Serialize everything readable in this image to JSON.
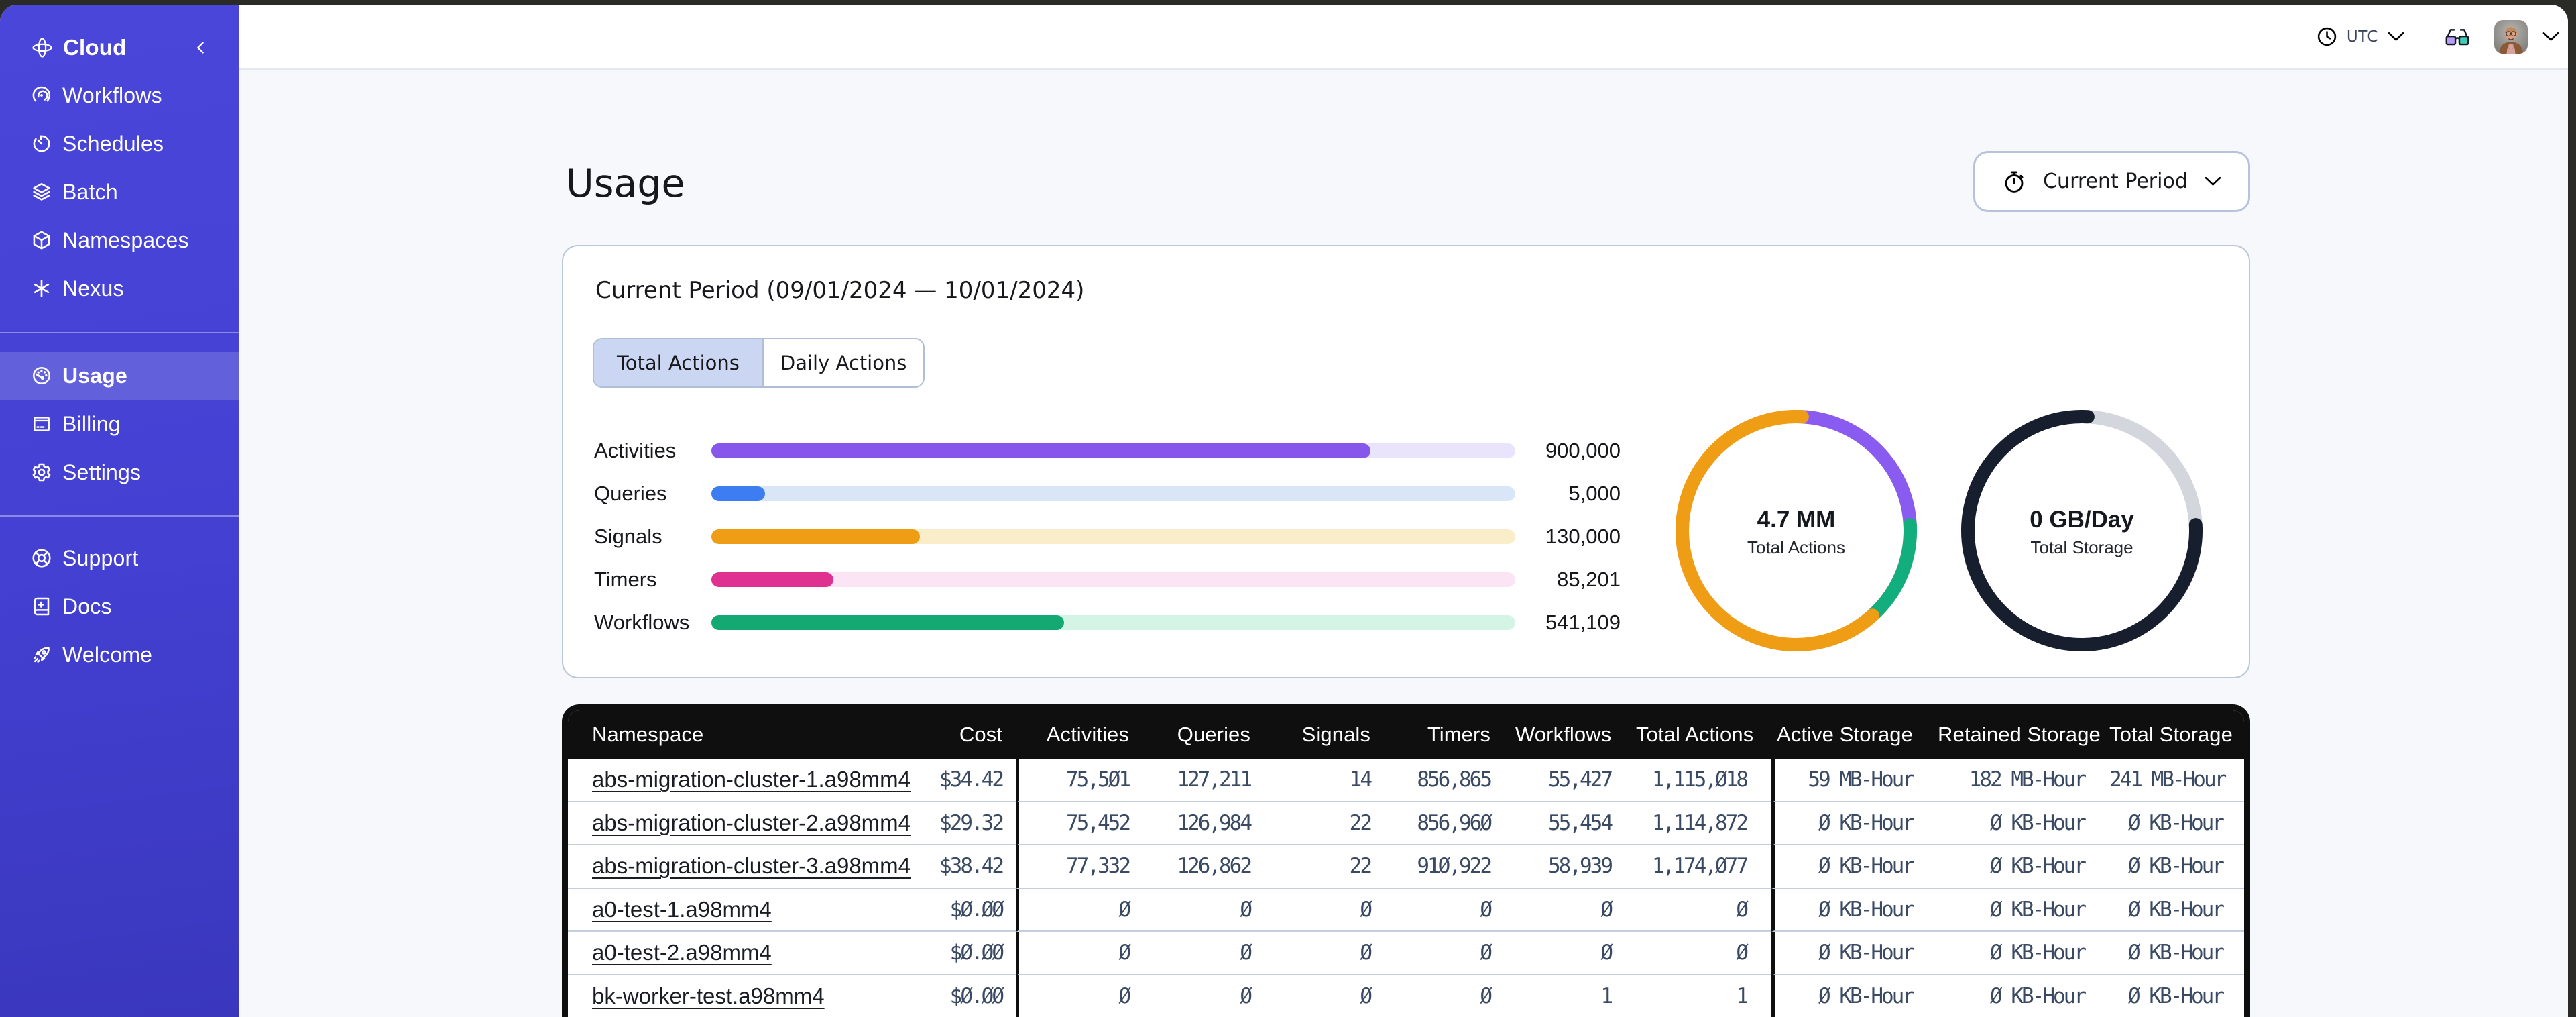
{
  "app": {
    "accent_color": "#4a46d9",
    "page_background": "#f7f8fb",
    "frame_color": "#2a2a26"
  },
  "sidebar": {
    "brand": {
      "label": "Cloud",
      "icon": "cloud-logo-icon"
    },
    "sections": [
      {
        "items": [
          {
            "label": "Workflows",
            "icon": "workflows-icon"
          },
          {
            "label": "Schedules",
            "icon": "schedules-icon"
          },
          {
            "label": "Batch",
            "icon": "batch-icon"
          },
          {
            "label": "Namespaces",
            "icon": "namespaces-icon"
          },
          {
            "label": "Nexus",
            "icon": "nexus-icon"
          }
        ]
      },
      {
        "items": [
          {
            "label": "Usage",
            "icon": "usage-icon",
            "active": true
          },
          {
            "label": "Billing",
            "icon": "billing-icon"
          },
          {
            "label": "Settings",
            "icon": "settings-icon"
          }
        ]
      },
      {
        "items": [
          {
            "label": "Support",
            "icon": "support-icon"
          },
          {
            "label": "Docs",
            "icon": "docs-icon"
          },
          {
            "label": "Welcome",
            "icon": "welcome-icon"
          }
        ]
      }
    ]
  },
  "topbar": {
    "timezone": "UTC"
  },
  "page": {
    "title": "Usage",
    "period_button": {
      "label": "Current Period"
    }
  },
  "panel": {
    "title": "Current Period (09/01/2024 — 10/01/2024)",
    "tabs": [
      {
        "label": "Total Actions",
        "active": true
      },
      {
        "label": "Daily Actions",
        "active": false
      }
    ]
  },
  "chart_data": [
    {
      "type": "bar",
      "title": "Actions by type (current period)",
      "categories": [
        "Activities",
        "Queries",
        "Signals",
        "Timers",
        "Workflows"
      ],
      "values": [
        900000,
        5000,
        130000,
        85201,
        541109
      ],
      "value_labels": [
        "900,000",
        "5,000",
        "130,000",
        "85,201",
        "541,109"
      ],
      "fill_fractions": [
        0.82,
        0.067,
        0.259,
        0.152,
        0.439
      ],
      "bar_colors": [
        "#8657ea",
        "#3c7df2",
        "#f09d16",
        "#de3190",
        "#14a873"
      ],
      "track_colors": [
        "#e9e3fb",
        "#d9e6f8",
        "#faedc9",
        "#fbe5f4",
        "#d4f5e5"
      ],
      "xlabel": "",
      "ylabel": "",
      "legend": false
    },
    {
      "type": "pie",
      "center_value": "4.7 MM",
      "center_label": "Total Actions",
      "base_color": "#f09d16",
      "segments": [
        {
          "name": "purple-segment",
          "color": "#8a5bf0",
          "start_deg": 3,
          "end_deg": 87
        },
        {
          "name": "green-segment",
          "color": "#12ae7d",
          "start_deg": 87,
          "end_deg": 138
        },
        {
          "name": "orange-segment",
          "color": "#f09d16",
          "start_deg": 138,
          "end_deg": 363
        }
      ]
    },
    {
      "type": "pie",
      "center_value": "0 GB/Day",
      "center_label": "Total Storage",
      "base_color": "#d3d6dc",
      "segments": [
        {
          "name": "dark-segment",
          "color": "#171e2e",
          "start_deg": 87,
          "end_deg": 363
        }
      ]
    }
  ],
  "table": {
    "columns": [
      {
        "id": "namespace",
        "label": "Namespace",
        "align": "left"
      },
      {
        "id": "cost",
        "label": "Cost",
        "align": "right"
      },
      {
        "id": "activities",
        "label": "Activities",
        "align": "right",
        "group_start": true
      },
      {
        "id": "queries",
        "label": "Queries",
        "align": "right"
      },
      {
        "id": "signals",
        "label": "Signals",
        "align": "right"
      },
      {
        "id": "timers",
        "label": "Timers",
        "align": "right"
      },
      {
        "id": "workflows",
        "label": "Workflows",
        "align": "right"
      },
      {
        "id": "total_actions",
        "label": "Total Actions",
        "align": "right"
      },
      {
        "id": "active_storage",
        "label": "Active Storage",
        "align": "right",
        "group_start": true
      },
      {
        "id": "retained_storage",
        "label": "Retained Storage",
        "align": "right"
      },
      {
        "id": "total_storage",
        "label": "Total Storage",
        "align": "right"
      }
    ],
    "rows": [
      {
        "namespace": "abs-migration-cluster-1.a98mm4",
        "cells": [
          "$34.42",
          "75,501",
          "127,211",
          "14",
          "856,865",
          "55,427",
          "1,115,018",
          "59 MB-Hour",
          "182 MB-Hour",
          "241 MB-Hour"
        ]
      },
      {
        "namespace": "abs-migration-cluster-2.a98mm4",
        "cells": [
          "$29.32",
          "75,452",
          "126,984",
          "22",
          "856,960",
          "55,454",
          "1,114,872",
          "0 KB-Hour",
          "0 KB-Hour",
          "0 KB-Hour"
        ]
      },
      {
        "namespace": "abs-migration-cluster-3.a98mm4",
        "cells": [
          "$38.42",
          "77,332",
          "126,862",
          "22",
          "910,922",
          "58,939",
          "1,174,077",
          "0 KB-Hour",
          "0 KB-Hour",
          "0 KB-Hour"
        ]
      },
      {
        "namespace": "a0-test-1.a98mm4",
        "cells": [
          "$0.00",
          "0",
          "0",
          "0",
          "0",
          "0",
          "0",
          "0 KB-Hour",
          "0 KB-Hour",
          "0 KB-Hour"
        ]
      },
      {
        "namespace": "a0-test-2.a98mm4",
        "cells": [
          "$0.00",
          "0",
          "0",
          "0",
          "0",
          "0",
          "0",
          "0 KB-Hour",
          "0 KB-Hour",
          "0 KB-Hour"
        ]
      },
      {
        "namespace": "bk-worker-test.a98mm4",
        "cells": [
          "$0.00",
          "0",
          "0",
          "0",
          "0",
          "1",
          "1",
          "0 KB-Hour",
          "0 KB-Hour",
          "0 KB-Hour"
        ]
      }
    ]
  }
}
